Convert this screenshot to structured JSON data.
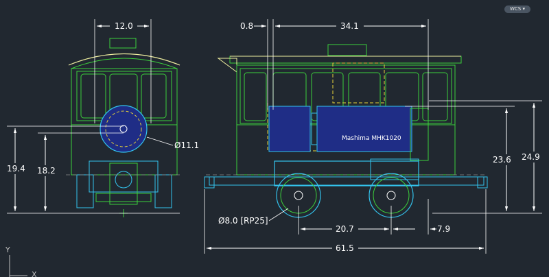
{
  "viewport": {
    "wcs_label": "WCS",
    "wcs_arrow": "chevron-down-icon"
  },
  "ucs": {
    "y_label": "Y",
    "x_label": "X"
  },
  "drawing": {
    "motor_label": "Mashima MHK1020",
    "front_view": {
      "width_dim": "12.0",
      "diameter_dim": "Ø11.1",
      "height_outer_dim": "19.4",
      "height_inner_dim": "18.2"
    },
    "side_view": {
      "offset_dim": "0.8",
      "length_top_dim": "34.1",
      "wheel_dim": "Ø8.0 [RP25]",
      "wheelbase_dim": "20.7",
      "overhang_dim": "7.9",
      "overall_length_dim": "61.5",
      "height_inner_dim": "23.6",
      "height_outer_dim": "24.9"
    }
  },
  "colors": {
    "background": "#212830",
    "body_line": "#3cd13c",
    "chassis_line": "#33c4ee",
    "motor_fill": "#1f2d86",
    "dashed_line": "#e6d23a",
    "dimension_line": "#ffffff",
    "roof_line": "#f0f0a0",
    "center_mark": "#3cd13c"
  }
}
